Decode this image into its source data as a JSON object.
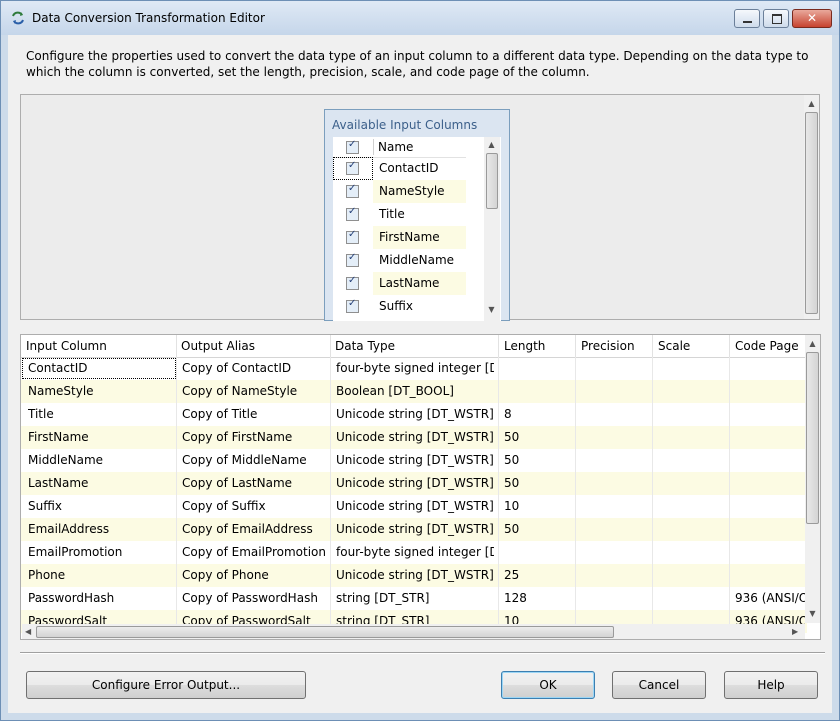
{
  "window": {
    "title": "Data Conversion Transformation Editor",
    "icon": "data-conversion-icon"
  },
  "description": "Configure the properties used to convert the data type of an input column to a different data type. Depending on the data type to which the column is converted, set the length, precision, scale, and code page of the column.",
  "available": {
    "title": "Available Input Columns",
    "header": "Name",
    "items": [
      {
        "name": "ContactID",
        "checked": true
      },
      {
        "name": "NameStyle",
        "checked": true
      },
      {
        "name": "Title",
        "checked": true
      },
      {
        "name": "FirstName",
        "checked": true
      },
      {
        "name": "MiddleName",
        "checked": true
      },
      {
        "name": "LastName",
        "checked": true
      },
      {
        "name": "Suffix",
        "checked": true
      }
    ]
  },
  "grid": {
    "headers": [
      "Input Column",
      "Output Alias",
      "Data Type",
      "Length",
      "Precision",
      "Scale",
      "Code Page"
    ],
    "rows": [
      [
        "ContactID",
        "Copy of ContactID",
        "four-byte signed integer [D...",
        "",
        "",
        "",
        ""
      ],
      [
        "NameStyle",
        "Copy of NameStyle",
        "Boolean [DT_BOOL]",
        "",
        "",
        "",
        ""
      ],
      [
        "Title",
        "Copy of Title",
        "Unicode string [DT_WSTR]",
        "8",
        "",
        "",
        ""
      ],
      [
        "FirstName",
        "Copy of FirstName",
        "Unicode string [DT_WSTR]",
        "50",
        "",
        "",
        ""
      ],
      [
        "MiddleName",
        "Copy of MiddleName",
        "Unicode string [DT_WSTR]",
        "50",
        "",
        "",
        ""
      ],
      [
        "LastName",
        "Copy of LastName",
        "Unicode string [DT_WSTR]",
        "50",
        "",
        "",
        ""
      ],
      [
        "Suffix",
        "Copy of Suffix",
        "Unicode string [DT_WSTR]",
        "10",
        "",
        "",
        ""
      ],
      [
        "EmailAddress",
        "Copy of EmailAddress",
        "Unicode string [DT_WSTR]",
        "50",
        "",
        "",
        ""
      ],
      [
        "EmailPromotion",
        "Copy of EmailPromotion",
        "four-byte signed integer [D...",
        "",
        "",
        "",
        ""
      ],
      [
        "Phone",
        "Copy of Phone",
        "Unicode string [DT_WSTR]",
        "25",
        "",
        "",
        ""
      ],
      [
        "PasswordHash",
        "Copy of PasswordHash",
        "string [DT_STR]",
        "128",
        "",
        "",
        "936   (ANSI/O"
      ],
      [
        "PasswordSalt",
        "Copy of PasswordSalt",
        "string [DT_STR]",
        "10",
        "",
        "",
        "936   (ANSI/O"
      ]
    ]
  },
  "buttons": {
    "error_output": "Configure Error Output...",
    "ok": "OK",
    "cancel": "Cancel",
    "help": "Help"
  }
}
